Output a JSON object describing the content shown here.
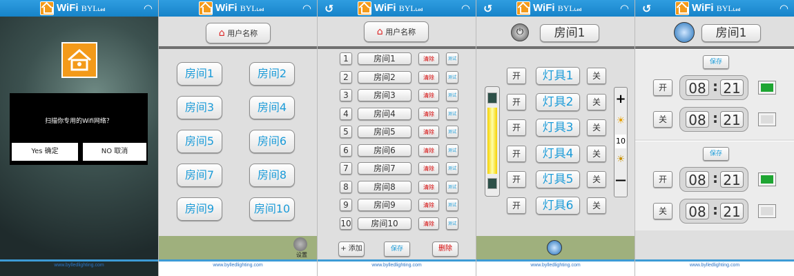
{
  "app": {
    "brand": "WiFi",
    "brand_suffix": "BYL",
    "brand_tag": "Led",
    "footer_url": "www.bylledlighting.com"
  },
  "colors": {
    "accent": "#1b9bd8",
    "header": "#1683c9",
    "band": "#9fb07d",
    "indicator_on": "#1ea532",
    "clear_text": "#d40000"
  },
  "screen1": {
    "dialog_text": "扫描你专用的Wifi网络？",
    "yes_label": "Yes 确定",
    "no_label": "NO 取消"
  },
  "screen2": {
    "user_label": "用户名称",
    "rooms": [
      "房间1",
      "房间2",
      "房间3",
      "房间4",
      "房间5",
      "房间6",
      "房间7",
      "房间8",
      "房间9",
      "房间10"
    ],
    "settings_label": "设置"
  },
  "screen3": {
    "user_label": "用户名称",
    "rows": [
      {
        "num": "1",
        "name": "房间1",
        "clear": "清除",
        "test": "测试"
      },
      {
        "num": "2",
        "name": "房间2",
        "clear": "清除",
        "test": "测试"
      },
      {
        "num": "3",
        "name": "房间3",
        "clear": "清除",
        "test": "测试"
      },
      {
        "num": "4",
        "name": "房间4",
        "clear": "清除",
        "test": "测试"
      },
      {
        "num": "5",
        "name": "房间5",
        "clear": "清除",
        "test": "测试"
      },
      {
        "num": "6",
        "name": "房间6",
        "clear": "清除",
        "test": "测试"
      },
      {
        "num": "7",
        "name": "房间7",
        "clear": "清除",
        "test": "测试"
      },
      {
        "num": "8",
        "name": "房间8",
        "clear": "清除",
        "test": "测试"
      },
      {
        "num": "9",
        "name": "房间9",
        "clear": "清除",
        "test": "测试"
      },
      {
        "num": "10",
        "name": "房间10",
        "clear": "清除",
        "test": "测试"
      }
    ],
    "add_label": "+ 添加",
    "save_label": "保存",
    "delete_label": "删除"
  },
  "screen4": {
    "room_label": "房间1",
    "on_label": "开",
    "off_label": "关",
    "lights": [
      "灯具1",
      "灯具2",
      "灯具3",
      "灯具4",
      "灯具5",
      "灯具6"
    ],
    "plus": "+",
    "minus": "—",
    "level": "10"
  },
  "screen5": {
    "room_label": "房间1",
    "save_label": "保存",
    "on_label": "开",
    "off_label": "关",
    "blocks": [
      {
        "on": {
          "h": "08",
          "m": "21",
          "active": true
        },
        "off": {
          "h": "08",
          "m": "21",
          "active": false
        }
      },
      {
        "on": {
          "h": "08",
          "m": "21",
          "active": true
        },
        "off": {
          "h": "08",
          "m": "21",
          "active": false
        }
      }
    ]
  },
  "icons": [
    "wifi-icon",
    "home-logo-icon",
    "back-icon",
    "house-icon",
    "gear-icon",
    "power-icon",
    "clock-icon",
    "bulb-icon"
  ]
}
